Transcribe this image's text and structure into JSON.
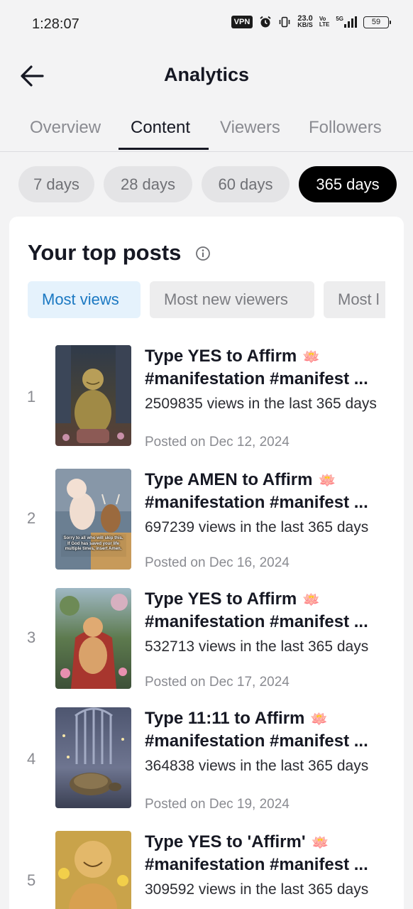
{
  "status": {
    "time": "1:28:07",
    "vpn": "VPN",
    "speed_value": "23.0",
    "speed_unit": "KB/S",
    "volte": "Vo",
    "volte_sub": "LTE",
    "network": "5G",
    "battery": "59"
  },
  "header": {
    "title": "Analytics"
  },
  "tabs": [
    {
      "label": "Overview"
    },
    {
      "label": "Content"
    },
    {
      "label": "Viewers"
    },
    {
      "label": "Followers"
    }
  ],
  "ranges": [
    {
      "label": "7 days"
    },
    {
      "label": "28 days"
    },
    {
      "label": "60 days"
    },
    {
      "label": "365 days"
    }
  ],
  "section": {
    "title": "Your top posts"
  },
  "filters": [
    {
      "label": "Most views"
    },
    {
      "label": "Most new viewers"
    },
    {
      "label": "Most l"
    }
  ],
  "posts": [
    {
      "rank": "1",
      "title1": "Type YES to Affirm",
      "emoji": "🪷",
      "title2": "#manifestation #manifest ...",
      "views": "2509835 views in the last 365 days",
      "date": "Posted on Dec 12, 2024"
    },
    {
      "rank": "2",
      "title1": "Type AMEN to Affirm",
      "emoji": "🪷",
      "title2": "#manifestation #manifest ...",
      "views": "697239 views in the last 365 days",
      "date": "Posted on Dec 16, 2024",
      "thumb_text": [
        "Sorry to all who will skip this.",
        "If God has saved your life",
        "multiple times, insert Amen."
      ]
    },
    {
      "rank": "3",
      "title1": "Type YES to Affirm",
      "emoji": "🪷",
      "title2": "#manifestation #manifest ...",
      "views": "532713 views in the last 365 days",
      "date": "Posted on Dec 17, 2024"
    },
    {
      "rank": "4",
      "title1": "Type 11:11 to Affirm",
      "emoji": "🪷",
      "title2": "#manifestation #manifest ...",
      "views": "364838 views in the last 365 days",
      "date": "Posted on Dec 19, 2024"
    },
    {
      "rank": "5",
      "title1": "Type YES to 'Affirm'",
      "emoji": "🪷",
      "title2": "#manifestation #manifest ...",
      "views": "309592 views in the last 365 days",
      "date": ""
    }
  ],
  "colors": {
    "accent": "#1a78c2",
    "active_chip": "#000000",
    "text": "#161823",
    "muted": "#8a8b91"
  }
}
